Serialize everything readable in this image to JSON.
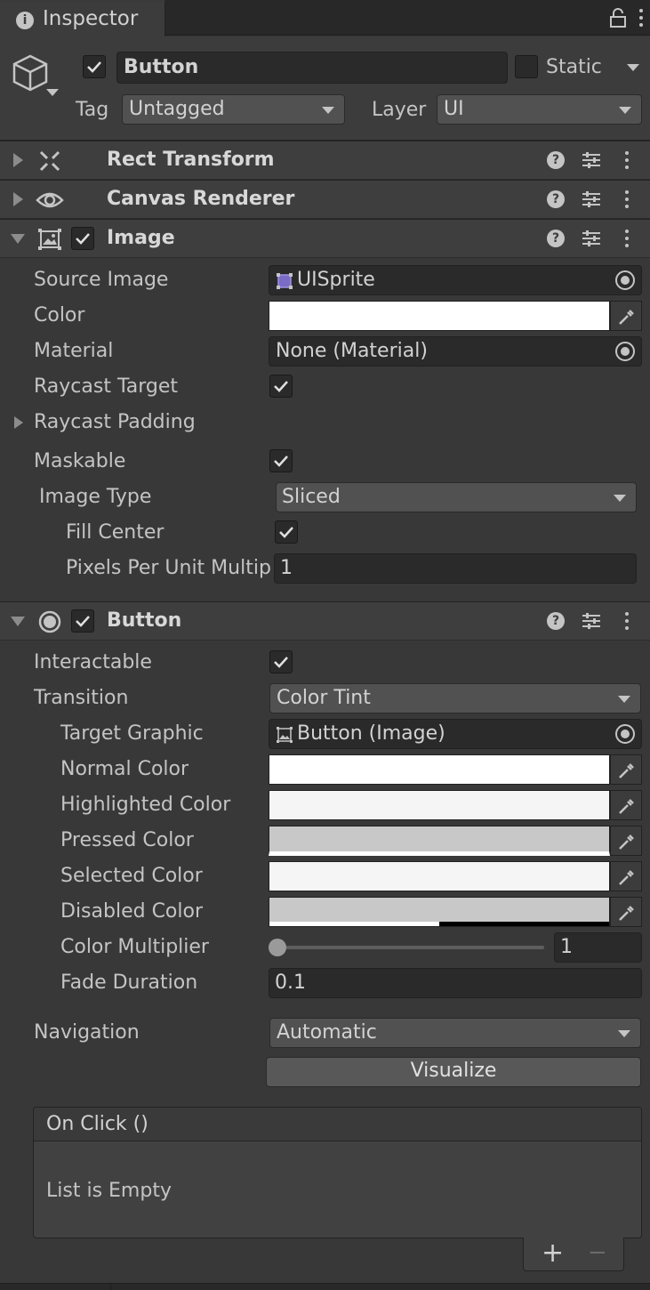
{
  "tab": {
    "title": "Inspector",
    "icon": "info-icon"
  },
  "header": {
    "object_name": "Button",
    "active": true,
    "static_label": "Static",
    "static_checked": false,
    "tag_label": "Tag",
    "tag_value": "Untagged",
    "layer_label": "Layer",
    "layer_value": "UI"
  },
  "components": {
    "rect_transform": {
      "title": "Rect Transform",
      "expanded": false
    },
    "canvas_renderer": {
      "title": "Canvas Renderer",
      "expanded": false
    },
    "image": {
      "title": "Image",
      "enabled": true,
      "source_image_label": "Source Image",
      "source_image_value": "UISprite",
      "color_label": "Color",
      "color_value": "#ffffff",
      "material_label": "Material",
      "material_value": "None (Material)",
      "raycast_target_label": "Raycast Target",
      "raycast_target": true,
      "raycast_padding_label": "Raycast Padding",
      "maskable_label": "Maskable",
      "maskable": true,
      "image_type_label": "Image Type",
      "image_type_value": "Sliced",
      "fill_center_label": "Fill Center",
      "fill_center": true,
      "ppu_label": "Pixels Per Unit Multiplier",
      "ppu_label_visible": "Pixels Per Unit Multip",
      "ppu_value": "1"
    },
    "button": {
      "title": "Button",
      "enabled": true,
      "interactable_label": "Interactable",
      "interactable": true,
      "transition_label": "Transition",
      "transition_value": "Color Tint",
      "target_graphic_label": "Target Graphic",
      "target_graphic_value": "Button (Image)",
      "normal_color_label": "Normal Color",
      "normal_color": "#ffffff",
      "highlighted_color_label": "Highlighted Color",
      "highlighted_color": "#f5f5f5",
      "pressed_color_label": "Pressed Color",
      "pressed_color": "#c8c8c8",
      "selected_color_label": "Selected Color",
      "selected_color": "#f5f5f5",
      "disabled_color_label": "Disabled Color",
      "disabled_color": "#c8c8c8",
      "disabled_alpha": 0.5,
      "color_multiplier_label": "Color Multiplier",
      "color_multiplier_value": "1",
      "color_multiplier_fraction": 0.0,
      "fade_duration_label": "Fade Duration",
      "fade_duration_value": "0.1",
      "navigation_label": "Navigation",
      "navigation_value": "Automatic",
      "visualize_label": "Visualize",
      "on_click_title": "On Click ()",
      "on_click_empty": "List is Empty",
      "add_label": "+",
      "remove_label": "−"
    }
  }
}
